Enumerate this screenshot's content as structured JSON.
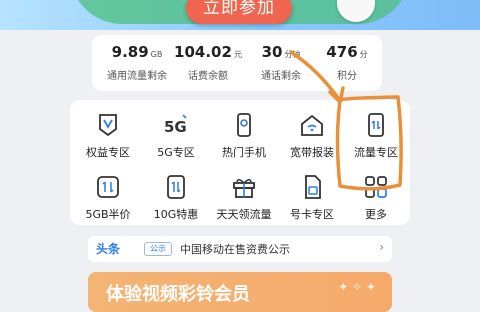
{
  "banner": {
    "join_label": "立即参加"
  },
  "stats": [
    {
      "value": "9.89",
      "unit": "GB",
      "label": "通用流量剩余"
    },
    {
      "value": "104.02",
      "unit": "元",
      "label": "话费余额"
    },
    {
      "value": "30",
      "unit": "分钟",
      "label": "通话剩余"
    },
    {
      "value": "476",
      "unit": "分",
      "label": "积分"
    }
  ],
  "services": [
    {
      "label": "权益专区",
      "icon": "badge-v-icon"
    },
    {
      "label": "5G专区",
      "icon": "5g-icon"
    },
    {
      "label": "热门手机",
      "icon": "phone-icon"
    },
    {
      "label": "宽带报装",
      "icon": "home-wifi-icon"
    },
    {
      "label": "流量专区",
      "icon": "data-transfer-icon"
    },
    {
      "label": "5GB半价",
      "icon": "data-sync-icon"
    },
    {
      "label": "10G特惠",
      "icon": "data-updown-icon"
    },
    {
      "label": "天天领流量",
      "icon": "gift-icon"
    },
    {
      "label": "号卡专区",
      "icon": "sim-card-icon"
    },
    {
      "label": "更多",
      "icon": "grid-more-icon"
    }
  ],
  "headline": {
    "tag": "头条",
    "pill": "公示",
    "text": "中国移动在售资费公示"
  },
  "promo": {
    "title": "体验视频彩铃会员"
  },
  "colors": {
    "accent": "#2f7de1",
    "highlight": "#e8913a",
    "join": "#f0654f"
  }
}
